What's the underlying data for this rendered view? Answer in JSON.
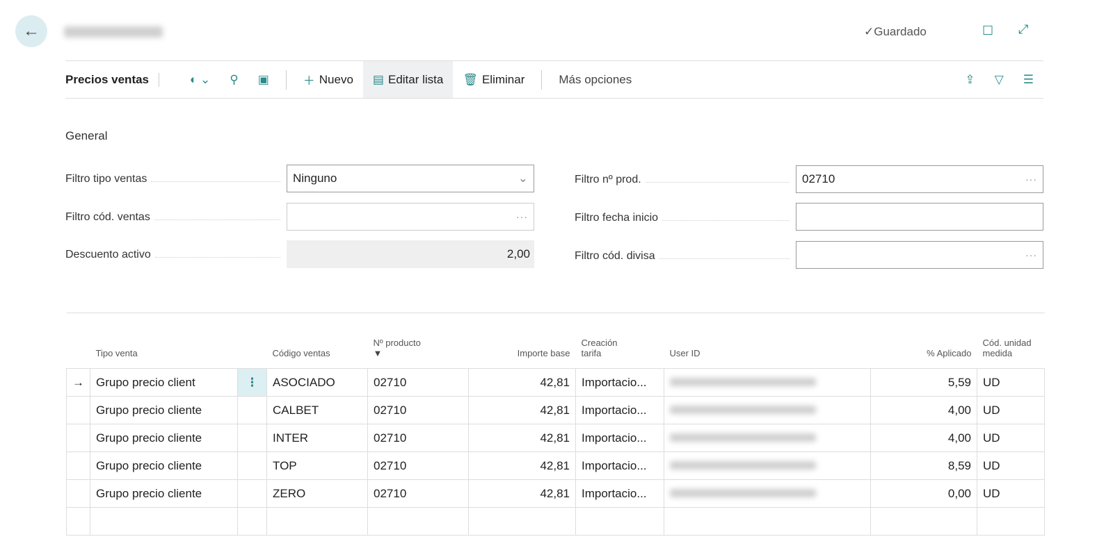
{
  "header": {
    "saved": "Guardado",
    "saved_icon": "check-icon"
  },
  "toolbar": {
    "title": "Precios ventas",
    "nuevo": "Nuevo",
    "editar": "Editar lista",
    "eliminar": "Eliminar",
    "mas": "Más opciones"
  },
  "general": {
    "title": "General",
    "filtro_tipo_ventas": {
      "label": "Filtro tipo ventas",
      "value": "Ninguno"
    },
    "filtro_cod_ventas": {
      "label": "Filtro cód. ventas",
      "value": ""
    },
    "descuento_activo": {
      "label": "Descuento activo",
      "value": "2,00"
    },
    "filtro_n_prod": {
      "label": "Filtro nº prod.",
      "value": "02710"
    },
    "filtro_fecha_inicio": {
      "label": "Filtro fecha inicio",
      "value": ""
    },
    "filtro_cod_divisa": {
      "label": "Filtro cód. divisa",
      "value": ""
    }
  },
  "table": {
    "headers": [
      "Tipo venta",
      "Código ventas",
      "Nº producto",
      "Importe base",
      "Creación",
      "tarifa",
      "User ID",
      "% Aplicado",
      "Cód. unidad",
      "medida"
    ],
    "rows": [
      [
        "Grupo precio client",
        "ASOCIADO",
        "02710",
        "42,81",
        "Importacio...",
        "5,59",
        "UD"
      ],
      [
        "Grupo precio cliente",
        "CALBET",
        "02710",
        "42,81",
        "Importacio...",
        "4,00",
        "UD"
      ],
      [
        "Grupo precio cliente",
        "INTER",
        "02710",
        "42,81",
        "Importacio...",
        "4,00",
        "UD"
      ],
      [
        "Grupo precio cliente",
        "TOP",
        "02710",
        "42,81",
        "Importacio...",
        "8,59",
        "UD"
      ],
      [
        "Grupo precio cliente",
        "ZERO",
        "02710",
        "42,81",
        "Importacio...",
        "0,00",
        "UD"
      ]
    ]
  }
}
